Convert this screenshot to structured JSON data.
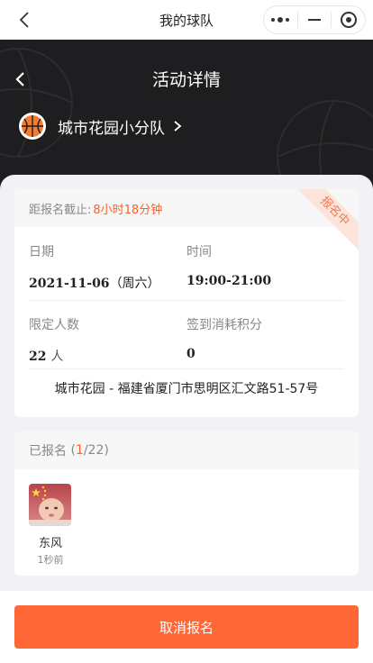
{
  "navbar": {
    "title": "我的球队"
  },
  "header": {
    "title": "活动详情",
    "team_name": "城市花园小分队"
  },
  "activity": {
    "deadline_label": "距报名截止:",
    "deadline_value": "8小时18分钟",
    "status_ribbon": "报名中",
    "date_label": "日期",
    "date_value": "2021-11-06",
    "date_weekday": "（周六）",
    "time_label": "时间",
    "time_value": "19:00-21:00",
    "limit_label": "限定人数",
    "limit_value": "22",
    "limit_unit": "人",
    "points_label": "签到消耗积分",
    "points_value": "0",
    "address": "城市花园 - 福建省厦门市思明区汇文路51-57号"
  },
  "signed": {
    "label": "已报名",
    "open": "(",
    "count": "1",
    "total": "/22)",
    "members": [
      {
        "name": "东风",
        "time": "1秒前"
      }
    ]
  },
  "footer": {
    "cancel_label": "取消报名"
  },
  "colors": {
    "accent": "#ff5c24",
    "header_bg": "#1e1e20",
    "button": "#ff6836"
  }
}
